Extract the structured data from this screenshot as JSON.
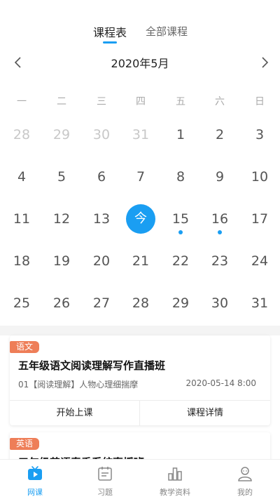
{
  "header": {
    "tabs": [
      {
        "label": "课程表",
        "active": true
      },
      {
        "label": "全部课程",
        "active": false
      }
    ]
  },
  "calendar": {
    "month_title": "2020年5月",
    "weekdays": [
      "一",
      "二",
      "三",
      "四",
      "五",
      "六",
      "日"
    ],
    "weeks": [
      [
        {
          "d": "28",
          "muted": true
        },
        {
          "d": "29",
          "muted": true
        },
        {
          "d": "30",
          "muted": true
        },
        {
          "d": "31",
          "muted": true
        },
        {
          "d": "1"
        },
        {
          "d": "2"
        },
        {
          "d": "3"
        }
      ],
      [
        {
          "d": "4"
        },
        {
          "d": "5"
        },
        {
          "d": "6"
        },
        {
          "d": "7"
        },
        {
          "d": "8"
        },
        {
          "d": "9"
        },
        {
          "d": "10"
        }
      ],
      [
        {
          "d": "11"
        },
        {
          "d": "12"
        },
        {
          "d": "13"
        },
        {
          "d": "今",
          "today": true
        },
        {
          "d": "15",
          "dot": true
        },
        {
          "d": "16",
          "dot": true
        },
        {
          "d": "17"
        }
      ],
      [
        {
          "d": "18"
        },
        {
          "d": "19"
        },
        {
          "d": "20"
        },
        {
          "d": "21"
        },
        {
          "d": "22"
        },
        {
          "d": "23"
        },
        {
          "d": "24"
        }
      ],
      [
        {
          "d": "25"
        },
        {
          "d": "26"
        },
        {
          "d": "27"
        },
        {
          "d": "28"
        },
        {
          "d": "29"
        },
        {
          "d": "30"
        },
        {
          "d": "31"
        }
      ]
    ]
  },
  "courses": [
    {
      "badge": "语文",
      "title": "五年级语文阅读理解写作直播班",
      "lesson": "01【阅读理解】人物心理细揣摩",
      "time": "2020-05-14 8:00",
      "start_label": "开始上课",
      "detail_label": "课程详情"
    },
    {
      "badge": "英语",
      "title": "五年级英语春季系统直播班"
    }
  ],
  "bottom_nav": [
    {
      "label": "网课",
      "icon": "tv-play-icon",
      "active": true
    },
    {
      "label": "习题",
      "icon": "calendar-list-icon",
      "active": false
    },
    {
      "label": "教学资料",
      "icon": "bar-chart-icon",
      "active": false
    },
    {
      "label": "我的",
      "icon": "user-icon",
      "active": false
    }
  ],
  "colors": {
    "accent": "#1a9ef2",
    "badge": "#ee7e58"
  }
}
